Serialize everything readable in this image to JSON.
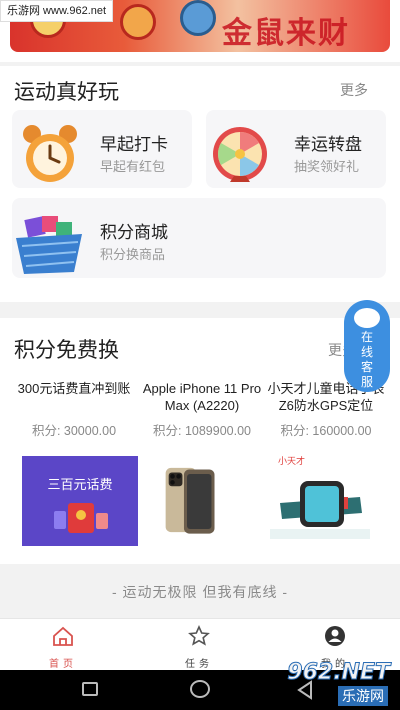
{
  "watermark": {
    "text": "乐游网 www.962.net"
  },
  "banner": {
    "text": "金鼠来财"
  },
  "fun": {
    "title": "运动真好玩",
    "more": "更多",
    "cards": [
      {
        "title": "早起打卡",
        "sub": "早起有红包",
        "icon": "alarm-clock-icon"
      },
      {
        "title": "幸运转盘",
        "sub": "抽奖领好礼",
        "icon": "prize-wheel-icon"
      },
      {
        "title": "积分商城",
        "sub": "积分换商品",
        "icon": "shopping-basket-icon"
      }
    ]
  },
  "exchange": {
    "title": "积分免费换",
    "more": "更多",
    "products": [
      {
        "name": "300元话费直冲到账",
        "price": "积分: 30000.00",
        "image_text": "三百元话费"
      },
      {
        "name": "Apple iPhone 11 Pro Max (A2220)",
        "price": "积分: 1089900.00"
      },
      {
        "name": "小天才儿童电话手表Z6防水GPS定位",
        "price": "积分: 160000.00",
        "image_text": "小天才"
      }
    ]
  },
  "slogan": "- 运动无极限 但我有底线 -",
  "tabs": [
    {
      "label": "首页",
      "icon": "home-icon",
      "active": true
    },
    {
      "label": "任务",
      "icon": "star-icon",
      "active": false
    },
    {
      "label": "我的",
      "icon": "user-icon",
      "active": false
    }
  ],
  "service": {
    "label": "在线客服"
  },
  "watermark_bottom": {
    "text": "962.NET",
    "sub": "乐游网"
  },
  "colors": {
    "accent": "#d9534f",
    "service": "#3d8fe0"
  }
}
